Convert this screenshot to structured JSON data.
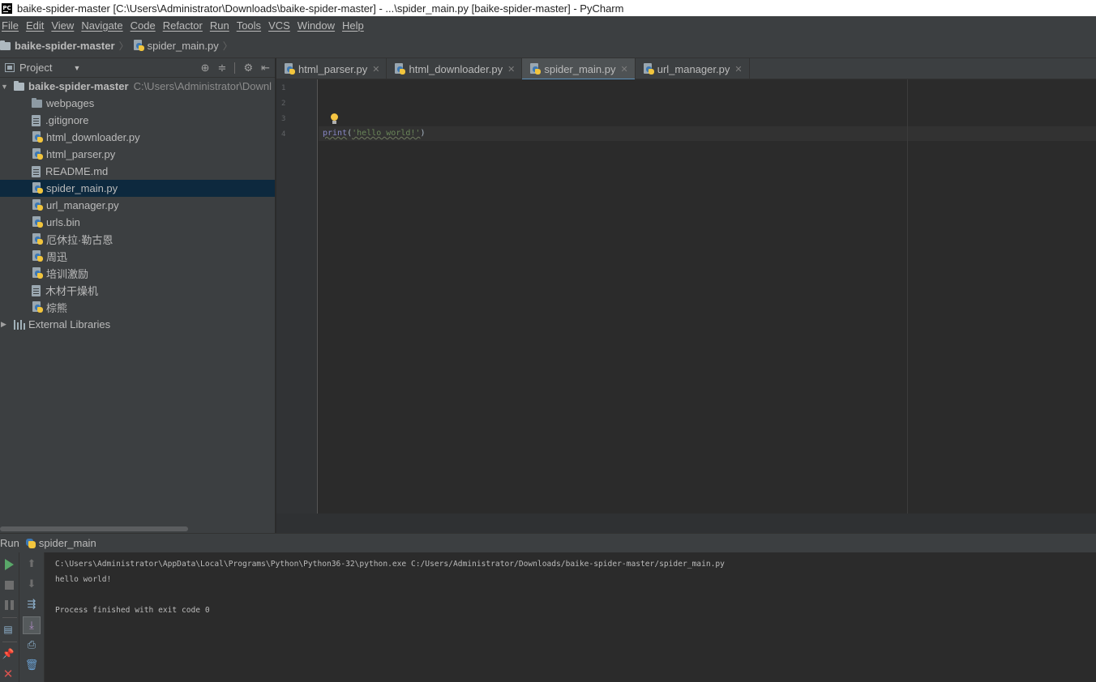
{
  "window": {
    "title": "baike-spider-master [C:\\Users\\Administrator\\Downloads\\baike-spider-master] - ...\\spider_main.py [baike-spider-master] - PyCharm",
    "logo_text": "PC"
  },
  "menu": [
    "File",
    "Edit",
    "View",
    "Navigate",
    "Code",
    "Refactor",
    "Run",
    "Tools",
    "VCS",
    "Window",
    "Help"
  ],
  "breadcrumb": {
    "project": "baike-spider-master",
    "file": "spider_main.py"
  },
  "project_panel": {
    "label": "Project",
    "root": {
      "name": "baike-spider-master",
      "path": "C:\\Users\\Administrator\\Downl"
    },
    "items": [
      {
        "name": "webpages",
        "icon": "folder-icon"
      },
      {
        "name": ".gitignore",
        "icon": "file-icon"
      },
      {
        "name": "html_downloader.py",
        "icon": "python-file-icon"
      },
      {
        "name": "html_parser.py",
        "icon": "python-file-icon"
      },
      {
        "name": "README.md",
        "icon": "file-icon"
      },
      {
        "name": "spider_main.py",
        "icon": "python-file-icon",
        "selected": true
      },
      {
        "name": "url_manager.py",
        "icon": "python-file-icon"
      },
      {
        "name": "urls.bin",
        "icon": "python-file-icon"
      },
      {
        "name": "厄休拉·勒古恩",
        "icon": "python-file-icon"
      },
      {
        "name": "周迅",
        "icon": "python-file-icon"
      },
      {
        "name": "培训激励",
        "icon": "python-file-icon"
      },
      {
        "name": "木材干燥机",
        "icon": "file-icon"
      },
      {
        "name": "棕熊",
        "icon": "python-file-icon"
      }
    ],
    "external": "External Libraries"
  },
  "tabs": [
    {
      "label": "html_parser.py",
      "active": false
    },
    {
      "label": "html_downloader.py",
      "active": false
    },
    {
      "label": "spider_main.py",
      "active": true
    },
    {
      "label": "url_manager.py",
      "active": false
    }
  ],
  "editor": {
    "line_numbers": [
      "1",
      "2",
      "3",
      "4"
    ],
    "code": {
      "fn": "print",
      "open": "(",
      "str": "'hello world!'",
      "close": ")"
    }
  },
  "run": {
    "title": "Run",
    "config": "spider_main",
    "console": [
      "C:\\Users\\Administrator\\AppData\\Local\\Programs\\Python\\Python36-32\\python.exe C:/Users/Administrator/Downloads/baike-spider-master/spider_main.py",
      "hello world!",
      "",
      "Process finished with exit code 0"
    ]
  },
  "colors": {
    "background": "#2b2b2b",
    "panel": "#3c3f41",
    "selection": "#0d293e",
    "run_green": "#59a869",
    "string": "#6a8759"
  }
}
